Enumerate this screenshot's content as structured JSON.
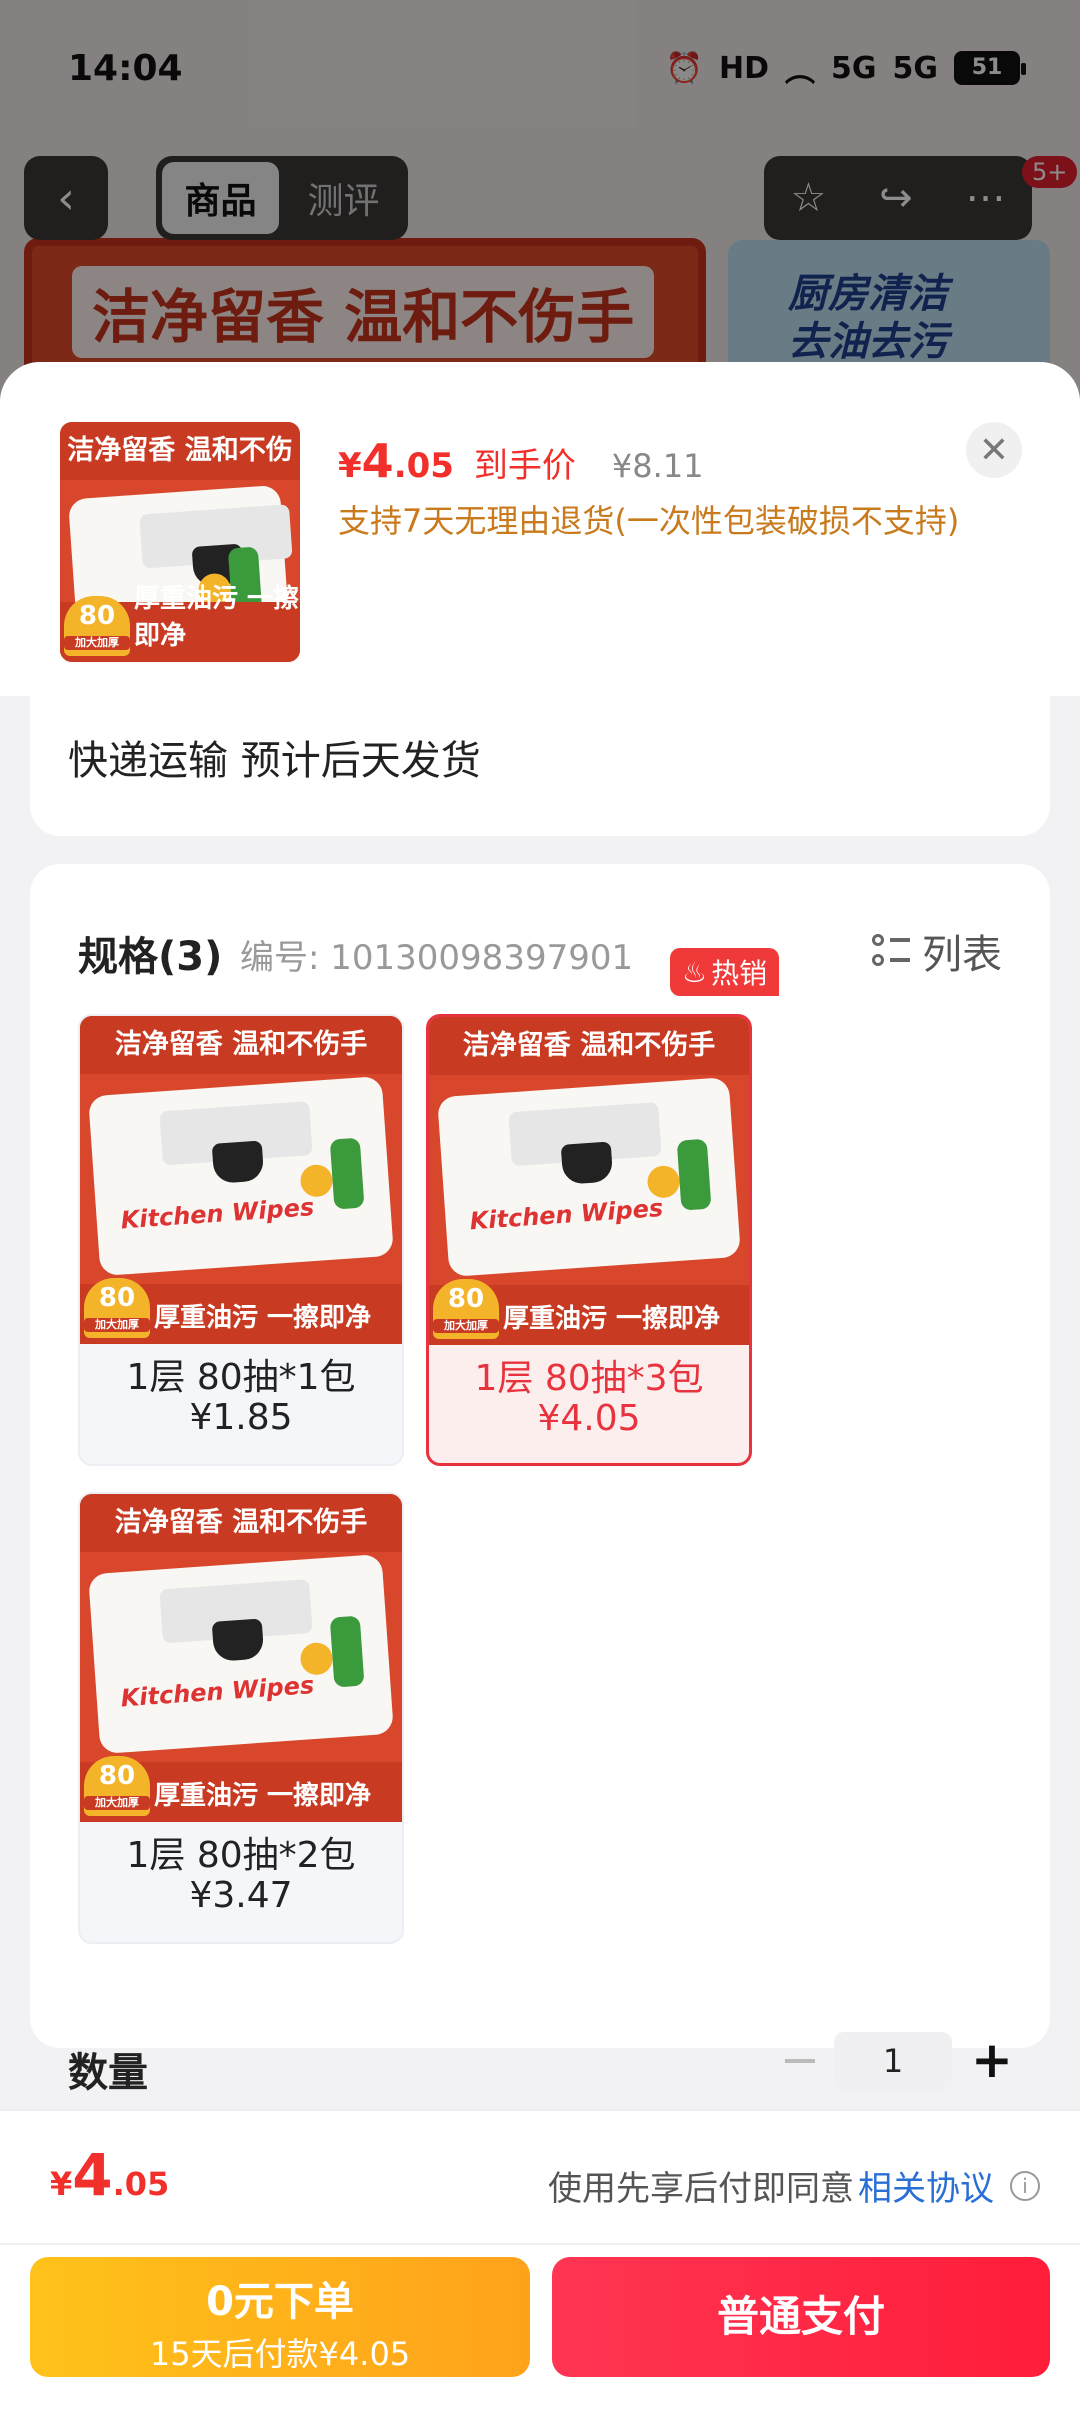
{
  "status_bar": {
    "time": "14:04",
    "hd_label": "HD",
    "net1": "5G",
    "net2": "5G",
    "battery": "51"
  },
  "nav": {
    "back_icon": "chevron-left-icon",
    "tabs": [
      {
        "label": "商品",
        "active": true
      },
      {
        "label": "测评",
        "active": false
      }
    ],
    "badge": "5+"
  },
  "background": {
    "banner_left_text": "洁净留香 温和不伤手",
    "banner_right_text": "厨房清洁\n去油去污"
  },
  "header": {
    "price_currency": "¥",
    "price_int": "4",
    "price_dec": ".05",
    "price_tag": "到手价",
    "original_price": "¥8.11",
    "return_policy": "支持7天无理由退货(一次性包装破损不支持)",
    "close_icon": "close-icon"
  },
  "product_image": {
    "top_text": "洁净留香 温和不伤手",
    "pack_text": "Kitchen Wipes",
    "bottom_text": "厚重油污 一擦即净",
    "count": "80",
    "count_sub": "加大加厚"
  },
  "shipping": {
    "text": "快递运输 预计后天发货"
  },
  "spec": {
    "title": "规格(3)",
    "code": "编号: 10130098397901",
    "list_label": "列表",
    "hot_label": "热销",
    "options": [
      {
        "name": "1层 80抽*1包",
        "price": "¥1.85",
        "selected": false
      },
      {
        "name": "1层 80抽*3包",
        "price": "¥4.05",
        "selected": true
      },
      {
        "name": "1层 80抽*2包",
        "price": "¥3.47",
        "selected": false
      }
    ]
  },
  "quantity": {
    "label": "数量",
    "value": "1",
    "minus": "−",
    "plus": "+"
  },
  "bottom": {
    "price_currency": "¥",
    "price_int": "4",
    "price_dec": ".05",
    "agree_prefix": "使用先享后付即同意",
    "agree_link": "相关协议",
    "info_icon": "i",
    "pay_later_main": "0元下单",
    "pay_later_sub": "15天后付款¥4.05",
    "pay_normal": "普通支付"
  },
  "colors": {
    "accent_red": "#f2302b",
    "selected_border": "#e8333e",
    "pay_later": "#ffb21b",
    "pay_normal": "#ff2a47",
    "link_blue": "#2a6fd6"
  }
}
